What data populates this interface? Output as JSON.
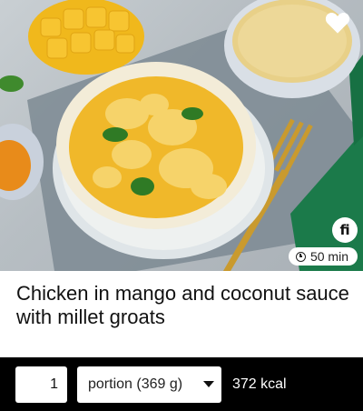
{
  "recipe": {
    "title": "Chicken in mango and coconut sauce with millet groats",
    "time": "50 min",
    "brand_badge": "fi",
    "favorite_icon": "heart-icon",
    "time_icon": "clock-icon"
  },
  "portion": {
    "quantity": "1",
    "unit_selected": "portion (369 g)",
    "calories": "372 kcal"
  }
}
